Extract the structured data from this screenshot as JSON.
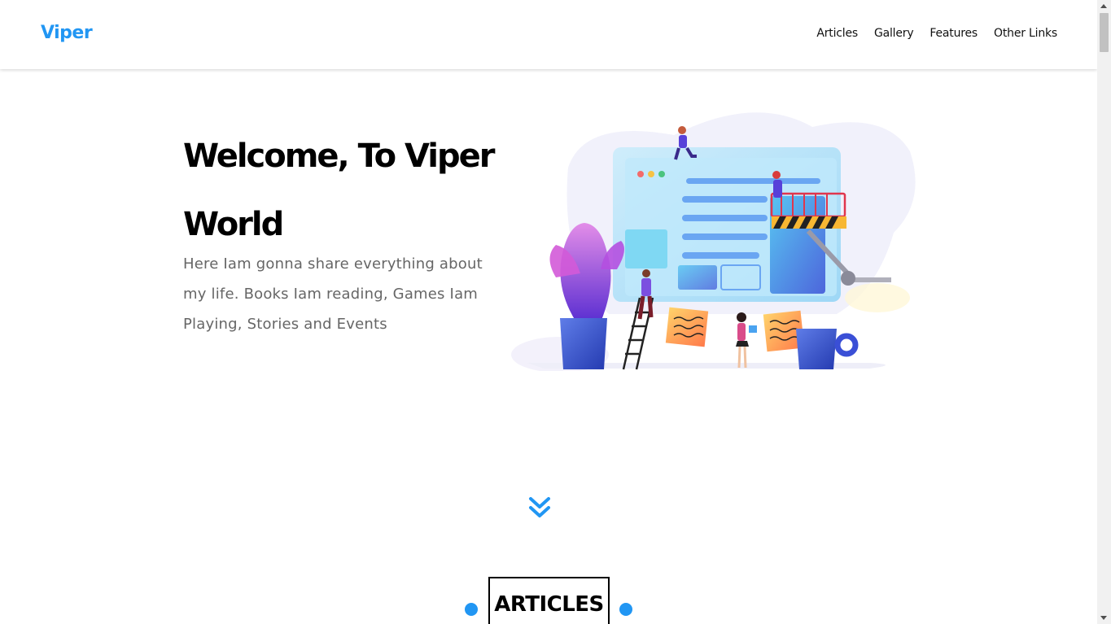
{
  "header": {
    "logo": "Viper",
    "nav": [
      "Articles",
      "Gallery",
      "Features",
      "Other Links"
    ]
  },
  "hero": {
    "title": "Welcome, To Viper World",
    "text": "Here Iam gonna share everything about my life. Books Iam reading, Games Iam Playing, Stories and Events"
  },
  "section": {
    "heading": "ARTICLES"
  },
  "icons": {
    "scroll": "double-chevron-down-icon"
  },
  "colors": {
    "accent": "#2196f3",
    "text": "#111111",
    "muted": "#666666"
  }
}
